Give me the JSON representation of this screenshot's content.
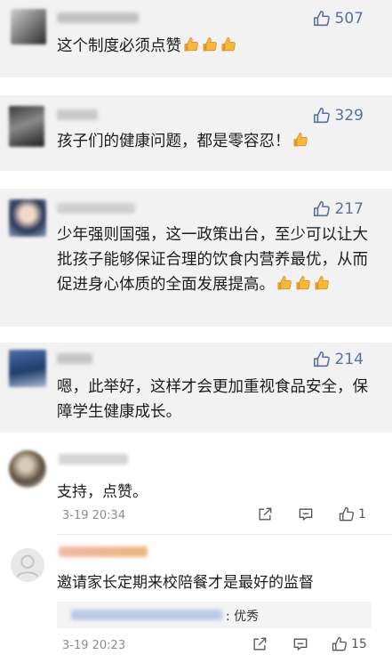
{
  "comments": [
    {
      "likes": "507",
      "text": "这个制度必须点赞"
    },
    {
      "likes": "329",
      "text": "孩子们的健康问题，都是零容忍！"
    },
    {
      "likes": "217",
      "text": "少年强则国强，这一政策出台，至少可以让大批孩子能够保证合理的饮食内营养最优，从而促进身心体质的全面发展提高。"
    },
    {
      "likes": "214",
      "text": "嗯，此举好，这样才会更加重视食品安全，保障学生健康成长。"
    }
  ],
  "replies": [
    {
      "text": "支持，点赞。",
      "time": "3-19 20:34",
      "like_count": "1"
    },
    {
      "text": "邀请家长定期来校陪餐才是最好的监督",
      "time": "3-19 20:23",
      "like_count": "15",
      "quote_suffix": ": 优秀"
    }
  ],
  "icons": {
    "like": "thumbs-up-outline-icon",
    "share": "share-icon",
    "comment": "comment-icon",
    "emoji": "thumbs-up-emoji-icon"
  },
  "colors": {
    "like_text": "#5a6f96",
    "background": "#f2f2f2",
    "reply_bg": "#ffffff"
  }
}
